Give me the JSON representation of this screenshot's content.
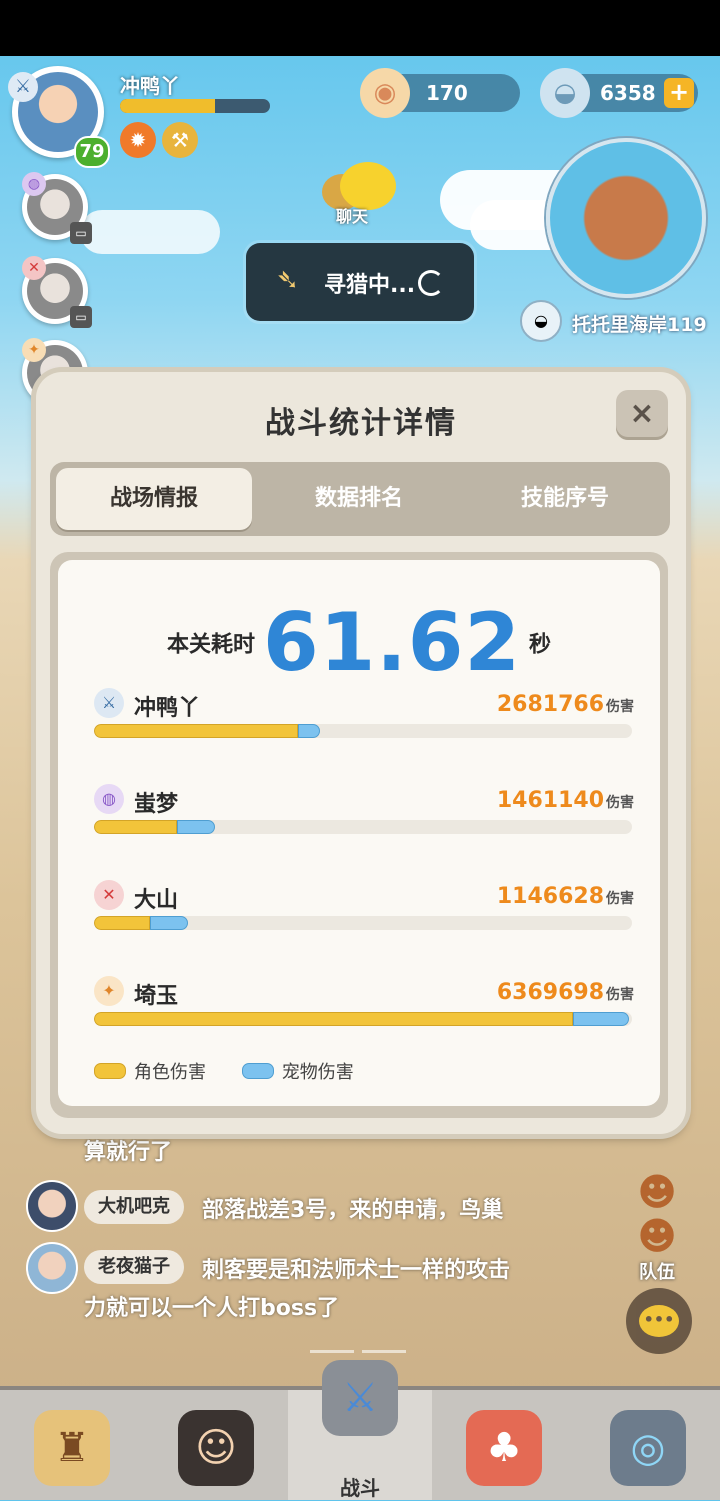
{
  "player": {
    "name": "冲鸭丫",
    "level": "79",
    "hp_fraction": 0.63
  },
  "currency": {
    "pearls": "170",
    "shells": "6358"
  },
  "chat_bubble_label": "聊天",
  "hunting": {
    "label": "寻猎中..."
  },
  "location": "托托里海岸119",
  "modal": {
    "title": "战斗统计详情",
    "close": "×",
    "tabs": [
      "战场情报",
      "数据排名",
      "技能序号"
    ],
    "time_label": "本关耗时",
    "time_value": "61.62",
    "time_unit": "秒",
    "damage_unit": "伤害",
    "players": [
      {
        "name": "冲鸭丫",
        "damage": "2681766",
        "char_fraction": 0.38,
        "pet_fraction": 0.04
      },
      {
        "name": "蚩梦",
        "damage": "1461140",
        "char_fraction": 0.155,
        "pet_fraction": 0.07
      },
      {
        "name": "大山",
        "damage": "1146628",
        "char_fraction": 0.105,
        "pet_fraction": 0.07
      },
      {
        "name": "埼玉",
        "damage": "6369698",
        "char_fraction": 0.89,
        "pet_fraction": 0.105
      }
    ],
    "legend": {
      "char": "角色伤害",
      "pet": "宠物伤害"
    }
  },
  "chat": {
    "partial_line": "算就行了",
    "messages": [
      {
        "name": "大机吧克",
        "text": "部落战差3号，来的申请，鸟巢"
      },
      {
        "name": "老夜猫子",
        "text": "刺客要是和法师术士一样的攻击",
        "text2": "力就可以一个人打boss了"
      }
    ],
    "team_label": "队伍"
  },
  "nav": {
    "battle": "战斗"
  },
  "colors": {
    "accent_blue": "#2f86d6",
    "damage_orange": "#ee8a1c",
    "char_bar": "#f2c43a",
    "pet_bar": "#7cc2ef"
  }
}
